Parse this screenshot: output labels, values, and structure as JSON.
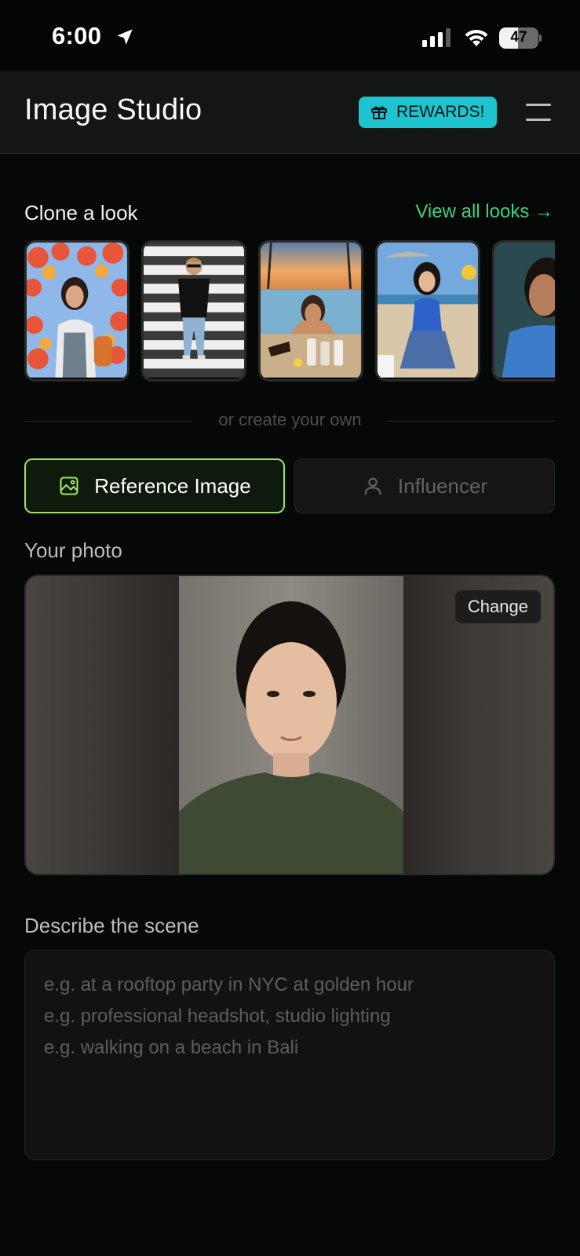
{
  "status_bar": {
    "time": "6:00",
    "battery": "47",
    "battery_level": 0.47
  },
  "header": {
    "title": "Image Studio",
    "rewards_label": "REWARDS!",
    "accent_color": "#1cc4cf"
  },
  "clone": {
    "title": "Clone a look",
    "view_all": "View all looks →",
    "looks": [
      {
        "icon": "look-flowers-selfie"
      },
      {
        "icon": "look-crosswalk"
      },
      {
        "icon": "look-beach-collage"
      },
      {
        "icon": "look-beach-sitting"
      },
      {
        "icon": "look-blue-shirt"
      }
    ]
  },
  "divider_text": "or create your own",
  "tabs": [
    {
      "label": "Reference Image",
      "active": true,
      "icon": "image-icon"
    },
    {
      "label": "Influencer",
      "active": false,
      "icon": "person-icon"
    }
  ],
  "photo": {
    "title": "Your photo",
    "change_label": "Change"
  },
  "scene": {
    "title": "Describe the scene",
    "placeholder_lines": [
      "e.g. at a rooftop party in NYC at golden hour",
      "e.g. professional headshot, studio lighting",
      "e.g. walking on a beach in Bali"
    ]
  },
  "colors": {
    "active_tab_border": "#9ee25d",
    "link_green": "#3fcf7e"
  }
}
